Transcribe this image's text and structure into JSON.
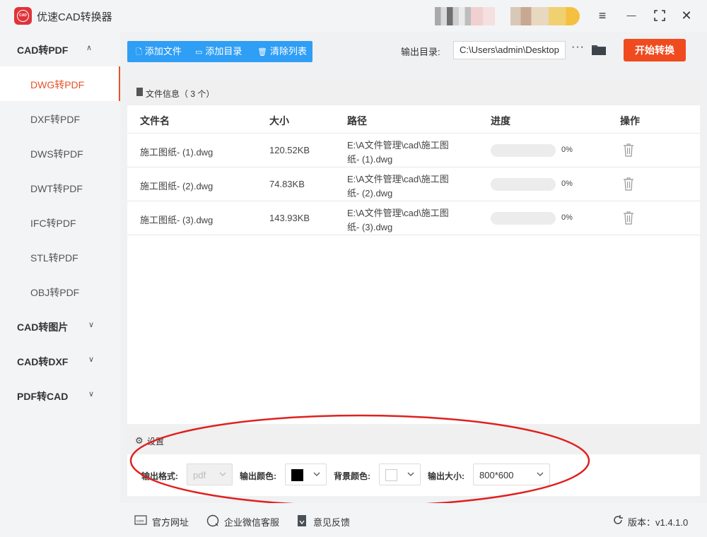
{
  "app": {
    "title": "优速CAD转换器",
    "logo_text": "CAD"
  },
  "window_controls": {
    "menu": "≡",
    "minimize": "—",
    "maximize": "⛶",
    "close": "✕"
  },
  "sidebar": {
    "groups": [
      {
        "label": "CAD转PDF",
        "expanded": true
      },
      {
        "label": "CAD转图片",
        "expanded": false
      },
      {
        "label": "CAD转DXF",
        "expanded": false
      },
      {
        "label": "PDF转CAD",
        "expanded": false
      }
    ],
    "items": [
      "DWG转PDF",
      "DXF转PDF",
      "DWS转PDF",
      "DWT转PDF",
      "IFC转PDF",
      "STL转PDF",
      "OBJ转PDF"
    ],
    "active_item": "DWG转PDF"
  },
  "toolbar": {
    "add_file": "添加文件",
    "add_dir": "添加目录",
    "clear_list": "清除列表",
    "output_label": "输出目录:",
    "output_path": "C:\\Users\\admin\\Desktop",
    "more": "···",
    "start": "开始转换"
  },
  "file_panel": {
    "title": "文件信息（ 3 个）",
    "columns": [
      "文件名",
      "大小",
      "路径",
      "进度",
      "操作"
    ],
    "rows": [
      {
        "name": "施工图纸- (1).dwg",
        "size": "120.52KB",
        "path_line1": "E:\\A文件管理\\cad\\施工图",
        "path_line2": "纸- (1).dwg",
        "progress": "0%"
      },
      {
        "name": "施工图纸- (2).dwg",
        "size": "74.83KB",
        "path_line1": "E:\\A文件管理\\cad\\施工图",
        "path_line2": "纸- (2).dwg",
        "progress": "0%"
      },
      {
        "name": "施工图纸- (3).dwg",
        "size": "143.93KB",
        "path_line1": "E:\\A文件管理\\cad\\施工图",
        "path_line2": "纸- (3).dwg",
        "progress": "0%"
      }
    ]
  },
  "settings": {
    "title": "设置",
    "format_label": "输出格式:",
    "format_value": "pdf",
    "color_label": "输出颜色:",
    "color_value": "#000000",
    "bg_label": "背景颜色:",
    "bg_value": "#ffffff",
    "size_label": "输出大小:",
    "size_value": "800*600"
  },
  "footer": {
    "website": "官方网址",
    "wechat": "企业微信客服",
    "feedback": "意见反馈",
    "version": "版本：v1.4.1.0"
  },
  "colors": {
    "accent": "#e8522a",
    "primary": "#2f9ef5",
    "start": "#f04a1f",
    "annotation": "#e02020"
  }
}
